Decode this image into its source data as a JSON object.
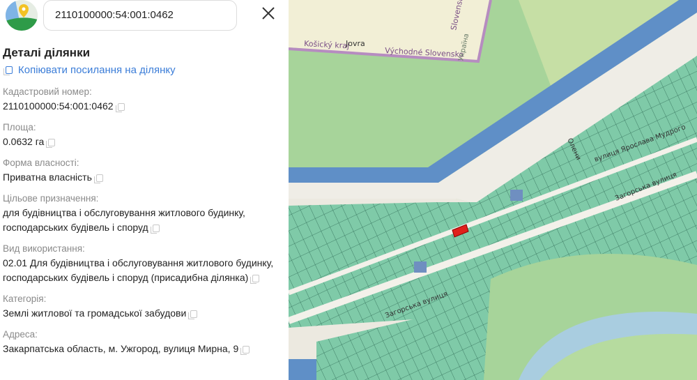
{
  "search": {
    "value": "2110100000:54:001:0462"
  },
  "panel": {
    "title": "Деталі ділянки",
    "copy_link": "Копіювати посилання на ділянку",
    "fields": [
      {
        "label": "Кадастровий номер:",
        "value": "2110100000:54:001:0462"
      },
      {
        "label": "Площа:",
        "value": "0.0632 га"
      },
      {
        "label": "Форма власності:",
        "value": "Приватна власність"
      },
      {
        "label": "Цільове призначення:",
        "value": "для будівництва і обслуговування житлового будинку, господарських будівель і споруд"
      },
      {
        "label": "Вид використання:",
        "value": "02.01 Для будівництва і обслуговування житлового будинку, господарських будівель і споруд (присадибна ділянка)"
      },
      {
        "label": "Категорія:",
        "value": "Землі житлової та громадської забудови"
      },
      {
        "label": "Адреса:",
        "value": "Закарпатська область, м. Ужгород, вулиця Мирна, 9"
      }
    ]
  },
  "map": {
    "labels": {
      "kosicky": "Košický kraj",
      "jovra": "Jovra",
      "vychodne": "Východné Slovensko",
      "slovensko": "Slovensko",
      "ukraina": "Україна",
      "mudroho": "вулиця Ярослава Мудрого",
      "zahorska1": "Загорська вулиця",
      "zahorska2": "Загорська вулиця",
      "oleny": "Олени"
    },
    "colors": {
      "selected_parcel": "#e0201c",
      "parcel": "#7fcaa8",
      "water": "#6f9bd0",
      "forest": "#a7d49a"
    }
  }
}
